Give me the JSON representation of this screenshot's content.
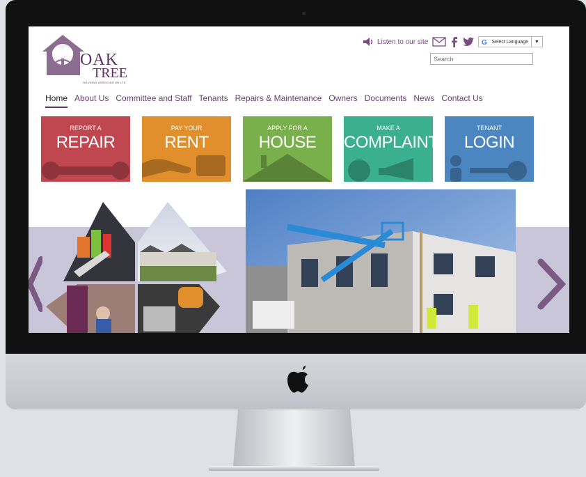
{
  "logo": {
    "line1": "OAK",
    "line2": "TREE",
    "subtitle": "HOUSING ASSOCIATION LTD"
  },
  "topbar": {
    "listen_label": "Listen to our site",
    "language_label": "Select Language",
    "language_arrow": "▼",
    "search_placeholder": "Search"
  },
  "nav": {
    "items": [
      "Home",
      "About Us",
      "Committee and Staff",
      "Tenants",
      "Repairs & Maintenance",
      "Owners",
      "Documents",
      "News",
      "Contact Us"
    ],
    "active": "Home"
  },
  "tiles": [
    {
      "small": "REPORT A",
      "big": "REPAIR",
      "color": "#c0464f"
    },
    {
      "small": "PAY YOUR",
      "big": "RENT",
      "color": "#e08f2c"
    },
    {
      "small": "APPLY FOR A",
      "big": "HOUSE",
      "color": "#79b04c"
    },
    {
      "small": "MAKE A",
      "big": "COMPLAINT",
      "color": "#3ab08f"
    },
    {
      "small": "TENANT",
      "big": "LOGIN",
      "color": "#4b86c1"
    }
  ],
  "colors": {
    "brand": "#5d3463",
    "slider_band": "#c9c6da",
    "arrow": "#7a5a82"
  },
  "icons": [
    "speaker-icon",
    "mail-icon",
    "facebook-icon",
    "twitter-icon",
    "google-icon",
    "apple-logo"
  ]
}
